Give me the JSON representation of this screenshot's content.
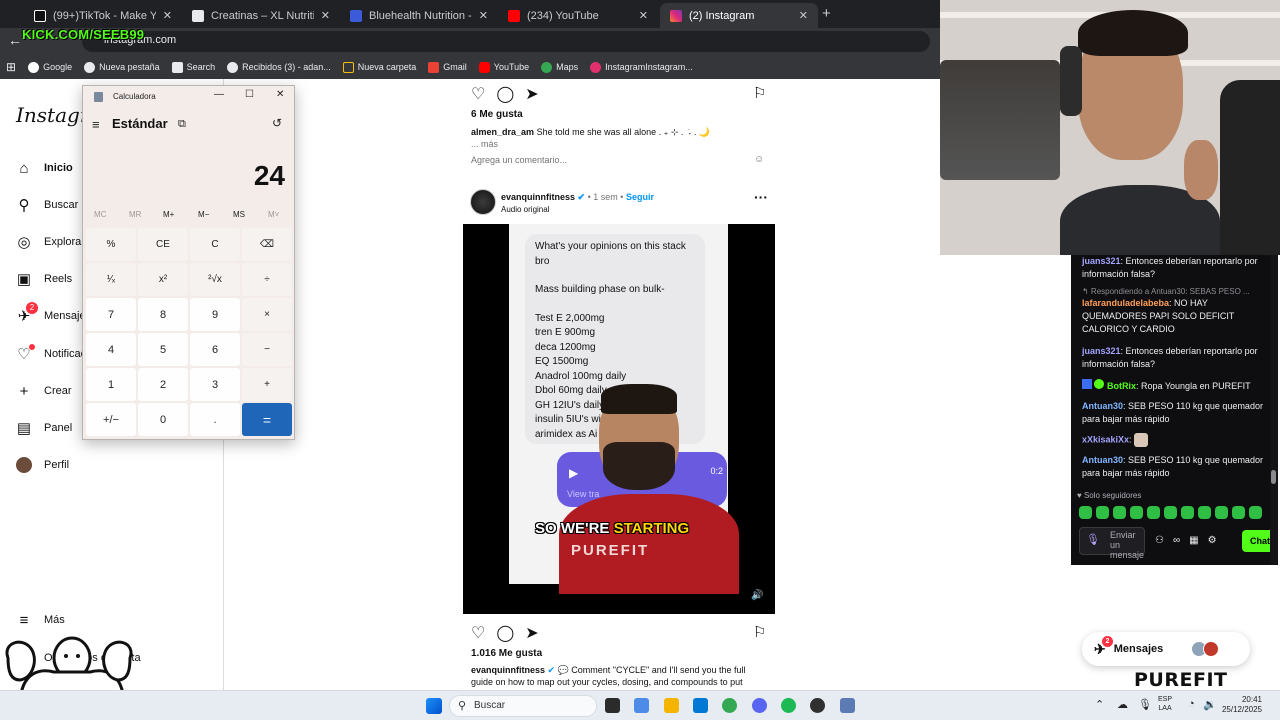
{
  "browser": {
    "tabs": [
      {
        "title": "(99+)TikTok - Make Your Day",
        "color": "#ffffff"
      },
      {
        "title": "Creatinas – XL Nutrition",
        "color": "#e8eaed"
      },
      {
        "title": "Bluehealth Nutrition - Calidad G",
        "color": "#3b5bdb"
      },
      {
        "title": "(234) YouTube",
        "color": "#ff0000"
      },
      {
        "title": "(2) Instagram",
        "color": "#e1306c"
      }
    ],
    "url": "instagram.com",
    "kick_overlay": "KICK.COM/SEEB99",
    "bookmarks": [
      {
        "label": "Google",
        "color": "#ffffff"
      },
      {
        "label": "Nueva pestaña",
        "color": "#e8eaed"
      },
      {
        "label": "Search",
        "color": "#e8eaed"
      },
      {
        "label": "Recibidos (3) - adan...",
        "color": "#e8eaed"
      },
      {
        "label": "Nueva carpeta",
        "color": "#fbbc04"
      },
      {
        "label": "Gmail",
        "color": "#ea4335"
      },
      {
        "label": "YouTube",
        "color": "#ff0000"
      },
      {
        "label": "Maps",
        "color": "#34a853"
      },
      {
        "label": "InstagramInstagram...",
        "color": "#e1306c"
      }
    ]
  },
  "instagram": {
    "logo": "Instagram",
    "nav": [
      {
        "label": "Inicio",
        "icon": "home-icon",
        "glyph": "⌂",
        "bold": true
      },
      {
        "label": "Buscar",
        "icon": "search-icon",
        "glyph": "⚲"
      },
      {
        "label": "Explorar",
        "icon": "explore-icon",
        "glyph": "◎"
      },
      {
        "label": "Reels",
        "icon": "reels-icon",
        "glyph": "▣"
      },
      {
        "label": "Mensajes",
        "icon": "messages-icon",
        "glyph": "✈",
        "badge": "2"
      },
      {
        "label": "Notificaciones",
        "icon": "heart-icon",
        "glyph": "♡",
        "dot": true
      },
      {
        "label": "Crear",
        "icon": "plus-icon",
        "glyph": "+"
      },
      {
        "label": "Panel",
        "icon": "panel-icon",
        "glyph": "▤"
      },
      {
        "label": "Perfil",
        "icon": "profile-icon",
        "glyph": "●"
      }
    ],
    "more_label": "Más",
    "meta_apps_label": "Otras apps de Meta",
    "post1": {
      "likes": "6 Me gusta",
      "username": "almen_dra_am",
      "caption": "She told me she was all alone . ₊ ⊹ . ݁ ˖ . 🌙",
      "more": "... más",
      "add_comment": "Agrega un comentario..."
    },
    "post2": {
      "username": "evanquinnfitness",
      "verified": "✔",
      "time": "1 sem",
      "follow": "Seguir",
      "audio": "Audio original",
      "bubble_lines": [
        "What's your opinions on this stack",
        "bro",
        "",
        "Mass building phase on bulk-",
        "",
        "Test E 2,000mg",
        "tren E 900mg",
        "deca 1200mg",
        "EQ 1500mg",
        "Anadrol 100mg daily",
        "Dbol 60mg daily",
        "GH 12IU's daily",
        "insulin 5IU's wi",
        "arimidex as Ai"
      ],
      "voice_time": "0:2",
      "voice_view": "View tra",
      "shirt_text": "PUREFIT",
      "subtitle_start": "SO WE'RE",
      "subtitle_highlight": "STARTING",
      "likes": "1.016 Me gusta",
      "caption": "💬 Comment \"CYCLE\" and I'll send you the full guide on how to map out your cycles, dosing, and compounds to put"
    },
    "messages_pill": {
      "label": "Mensajes",
      "badge": "2"
    }
  },
  "calculator": {
    "title": "Calculadora",
    "mode": "Estándar",
    "display": "24",
    "memory": [
      {
        "label": "MC",
        "enabled": false
      },
      {
        "label": "MR",
        "enabled": false
      },
      {
        "label": "M+",
        "enabled": true
      },
      {
        "label": "M−",
        "enabled": true
      },
      {
        "label": "MS",
        "enabled": true
      },
      {
        "label": "M˅",
        "enabled": false
      }
    ],
    "keys": [
      [
        "%",
        "CE",
        "C",
        "⌫"
      ],
      [
        "¹⁄ₓ",
        "x²",
        "²√x",
        "÷"
      ],
      [
        "7",
        "8",
        "9",
        "×"
      ],
      [
        "4",
        "5",
        "6",
        "−"
      ],
      [
        "1",
        "2",
        "3",
        "+"
      ],
      [
        "+/−",
        "0",
        ".",
        "="
      ]
    ]
  },
  "stream_chat": {
    "messages": [
      {
        "user": "juans321",
        "cls": "u1",
        "text": "Entonces deberían reportarlo por información falsa?"
      },
      {
        "reply": "↰ Respondiendo a Antuan30: SEBAS PESO ..."
      },
      {
        "user": "lafaranduladelabeba",
        "cls": "u2",
        "text": "NO HAY QUEMADORES PAPI SOLO DEFICIT CALORICO Y CARDIO"
      },
      {
        "user": "juans321",
        "cls": "u1",
        "text": "Entonces deberían reportarlo por información falsa?"
      },
      {
        "user": "BotRix",
        "cls": "u3",
        "text": "Ropa Youngla en PUREFIT"
      },
      {
        "user": "Antuan30",
        "cls": "u4",
        "text": "SEB PESO 110 kg que quemador para bajar más rápido"
      },
      {
        "user": "xXkisakiXx",
        "cls": "u1",
        "text": ""
      },
      {
        "user": "Antuan30",
        "cls": "u4",
        "text": "SEB PESO 110 kg que quemador para bajar más rápido"
      }
    ],
    "followers_only": "♥ Solo seguidores",
    "input_placeholder": "Enviar un mensaje",
    "send_label": "Chat"
  },
  "brand_logo": "PUREFIT",
  "taskbar": {
    "search_placeholder": "Buscar",
    "lang_top": "ESP",
    "lang_bottom": "LAA",
    "time": "20:41",
    "date": "25/12/2025"
  }
}
